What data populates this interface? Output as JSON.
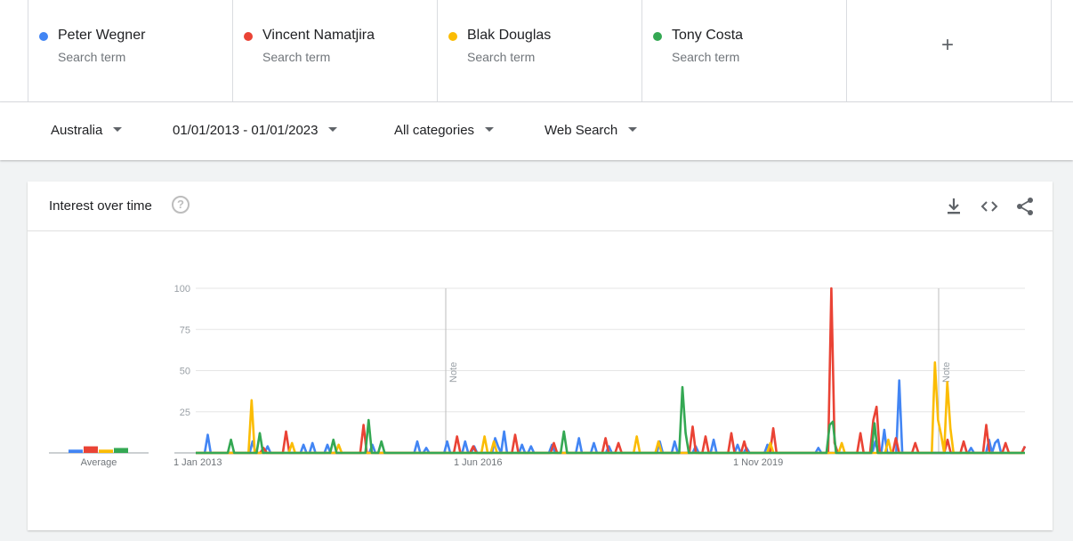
{
  "terms": [
    {
      "name": "Peter Wegner",
      "sub": "Search term",
      "color": "#4285f4"
    },
    {
      "name": "Vincent Namatjira",
      "sub": "Search term",
      "color": "#ea4335"
    },
    {
      "name": "Blak Douglas",
      "sub": "Search term",
      "color": "#fbbc04"
    },
    {
      "name": "Tony Costa",
      "sub": "Search term",
      "color": "#34a853"
    }
  ],
  "add_label": "+",
  "filters": {
    "region": "Australia",
    "date_range": "01/01/2013 - 01/01/2023",
    "category": "All categories",
    "search_type": "Web Search"
  },
  "card": {
    "title": "Interest over time",
    "help_glyph": "?",
    "icons": [
      "download-icon",
      "embed-icon",
      "share-icon"
    ]
  },
  "chart_data": {
    "type": "line",
    "ylim": [
      0,
      100
    ],
    "yticks": [
      "100",
      "75",
      "50",
      "25"
    ],
    "xticks": [
      "1 Jan 2013",
      "1 Jun 2016",
      "1 Nov 2019"
    ],
    "notes": [
      "Note",
      "Note"
    ],
    "average_label": "Average",
    "averages": [
      {
        "name": "Peter Wegner",
        "value": 2
      },
      {
        "name": "Vincent Namatjira",
        "value": 4
      },
      {
        "name": "Blak Douglas",
        "value": 2
      },
      {
        "name": "Tony Costa",
        "value": 3
      }
    ],
    "series": [
      {
        "name": "Peter Wegner",
        "color": "#4285f4",
        "values": [
          0,
          0,
          0,
          0,
          11,
          0,
          0,
          0,
          0,
          0,
          0,
          0,
          0,
          0,
          0,
          0,
          0,
          0,
          0,
          7,
          0,
          0,
          0,
          0,
          4,
          0,
          0,
          0,
          0,
          0,
          0,
          0,
          0,
          0,
          0,
          0,
          5,
          0,
          0,
          6,
          0,
          0,
          0,
          0,
          5,
          0,
          0,
          0,
          0,
          0,
          0,
          0,
          0,
          0,
          0,
          0,
          0,
          0,
          0,
          5,
          0,
          0,
          0,
          0,
          0,
          0,
          0,
          0,
          0,
          0,
          0,
          0,
          0,
          0,
          7,
          0,
          0,
          3,
          0,
          0,
          0,
          0,
          0,
          0,
          7,
          0,
          0,
          0,
          0,
          0,
          7,
          0,
          0,
          4,
          0,
          0,
          0,
          0,
          0,
          0,
          9,
          4,
          0,
          13,
          0,
          0,
          0,
          0,
          0,
          5,
          0,
          0,
          4,
          0,
          0,
          0,
          0,
          0,
          0,
          5,
          0,
          0,
          0,
          0,
          0,
          0,
          0,
          0,
          9,
          0,
          0,
          0,
          0,
          6,
          0,
          0,
          0,
          0,
          4,
          0,
          0,
          0,
          0,
          0,
          0,
          0,
          0,
          0,
          0,
          0,
          0,
          0,
          0,
          0,
          0,
          7,
          0,
          0,
          0,
          0,
          7,
          0,
          0,
          0,
          0,
          0,
          0,
          4,
          0,
          0,
          0,
          0,
          0,
          8,
          0,
          0,
          0,
          0,
          0,
          0,
          0,
          5,
          0,
          0,
          3,
          0,
          0,
          0,
          0,
          0,
          0,
          5,
          0,
          0,
          0,
          0,
          0,
          0,
          0,
          0,
          0,
          0,
          0,
          0,
          0,
          0,
          0,
          0,
          3,
          0,
          0,
          0,
          0,
          0,
          0,
          0,
          0,
          0,
          0,
          0,
          0,
          0,
          0,
          0,
          0,
          0,
          0,
          7,
          0,
          0,
          14,
          0,
          0,
          0,
          0,
          44,
          0,
          0,
          0,
          0,
          0,
          0,
          0,
          0,
          0,
          0,
          0,
          0,
          0,
          0,
          0,
          0,
          0,
          0,
          0,
          0,
          0,
          0,
          0,
          3,
          0,
          0,
          0,
          0,
          0,
          8,
          0,
          6,
          8,
          0,
          0,
          0,
          0,
          0,
          0,
          0,
          0,
          4
        ]
      },
      {
        "name": "Vincent Namatjira",
        "color": "#ea4335",
        "values": [
          0,
          0,
          0,
          0,
          0,
          0,
          0,
          0,
          0,
          0,
          0,
          0,
          0,
          0,
          0,
          0,
          0,
          0,
          0,
          0,
          0,
          3,
          0,
          0,
          0,
          0,
          0,
          0,
          13,
          0,
          0,
          0,
          0,
          0,
          0,
          0,
          0,
          0,
          0,
          0,
          0,
          0,
          0,
          0,
          0,
          0,
          0,
          0,
          0,
          0,
          0,
          0,
          17,
          0,
          0,
          0,
          0,
          0,
          0,
          0,
          0,
          0,
          0,
          0,
          0,
          0,
          0,
          0,
          0,
          0,
          0,
          0,
          0,
          0,
          0,
          0,
          0,
          0,
          0,
          0,
          0,
          10,
          0,
          0,
          0,
          0,
          4,
          0,
          0,
          0,
          0,
          0,
          0,
          0,
          0,
          0,
          0,
          0,
          0,
          11,
          0,
          0,
          0,
          0,
          0,
          0,
          0,
          0,
          0,
          0,
          0,
          6,
          0,
          0,
          0,
          0,
          0,
          0,
          0,
          0,
          0,
          0,
          0,
          0,
          0,
          0,
          0,
          9,
          0,
          0,
          0,
          6,
          0,
          0,
          0,
          0,
          0,
          0,
          0,
          0,
          0,
          0,
          0,
          0,
          0,
          0,
          0,
          0,
          0,
          0,
          0,
          0,
          0,
          0,
          16,
          0,
          0,
          0,
          10,
          0,
          0,
          0,
          0,
          0,
          0,
          0,
          12,
          0,
          0,
          0,
          7,
          0,
          0,
          0,
          0,
          0,
          0,
          0,
          0,
          15,
          0,
          0,
          0,
          0,
          0,
          0,
          0,
          0,
          0,
          0,
          0,
          0,
          0,
          0,
          0,
          0,
          0,
          100,
          6,
          0,
          0,
          0,
          0,
          0,
          0,
          0,
          12,
          0,
          0,
          0,
          20,
          28,
          0,
          0,
          0,
          0,
          0,
          9,
          0,
          0,
          0,
          0,
          0,
          6,
          0,
          0,
          0,
          0,
          0,
          0,
          0,
          0,
          0,
          8,
          0,
          0,
          0,
          0,
          7,
          0,
          0,
          0,
          0,
          0,
          0,
          17,
          0,
          0,
          0,
          0,
          0,
          6,
          0,
          0,
          0,
          0,
          0,
          4
        ]
      },
      {
        "name": "Blak Douglas",
        "color": "#fbbc04",
        "values": [
          0,
          0,
          0,
          0,
          0,
          0,
          0,
          0,
          0,
          0,
          0,
          0,
          0,
          0,
          0,
          0,
          0,
          0,
          32,
          0,
          0,
          0,
          0,
          0,
          0,
          0,
          0,
          0,
          0,
          0,
          0,
          6,
          0,
          0,
          0,
          0,
          0,
          0,
          0,
          0,
          0,
          0,
          0,
          0,
          0,
          0,
          5,
          0,
          0,
          0,
          0,
          0,
          0,
          0,
          0,
          0,
          0,
          0,
          0,
          0,
          0,
          0,
          0,
          0,
          0,
          0,
          0,
          0,
          0,
          0,
          0,
          0,
          0,
          0,
          0,
          0,
          0,
          0,
          0,
          0,
          0,
          0,
          0,
          0,
          0,
          0,
          0,
          0,
          0,
          0,
          0,
          0,
          0,
          10,
          0,
          0,
          7,
          0,
          0,
          0,
          0,
          0,
          0,
          0,
          0,
          0,
          0,
          0,
          0,
          0,
          0,
          0,
          0,
          0,
          0,
          0,
          0,
          0,
          0,
          0,
          0,
          0,
          0,
          0,
          0,
          0,
          0,
          0,
          0,
          0,
          0,
          0,
          0,
          0,
          0,
          0,
          0,
          0,
          0,
          0,
          0,
          0,
          10,
          0,
          0,
          0,
          0,
          0,
          0,
          7,
          0,
          0,
          0,
          0,
          0,
          0,
          0,
          0,
          0,
          0,
          0,
          0,
          0,
          0,
          0,
          0,
          0,
          0,
          0,
          0,
          0,
          0,
          0,
          0,
          0,
          0,
          0,
          0,
          0,
          0,
          0,
          0,
          0,
          0,
          0,
          6,
          0,
          0,
          0,
          0,
          0,
          0,
          0,
          0,
          0,
          0,
          0,
          0,
          0,
          0,
          0,
          0,
          0,
          0,
          0,
          0,
          0,
          0,
          6,
          0,
          0,
          0,
          0,
          0,
          0,
          0,
          0,
          0,
          0,
          0,
          0,
          0,
          0,
          8,
          0,
          0,
          0,
          0,
          0,
          0,
          0,
          0,
          0,
          0,
          0,
          0,
          0,
          0,
          55,
          20,
          11,
          0,
          43,
          15,
          0,
          0,
          0,
          0,
          0,
          0,
          0,
          0,
          0,
          0,
          0,
          0,
          0,
          0,
          0,
          0,
          0,
          0,
          0,
          0,
          0,
          0,
          0,
          0
        ]
      },
      {
        "name": "Tony Costa",
        "color": "#34a853",
        "values": [
          0,
          0,
          0,
          0,
          0,
          0,
          0,
          0,
          0,
          0,
          0,
          8,
          0,
          0,
          0,
          0,
          0,
          0,
          0,
          0,
          12,
          0,
          0,
          0,
          0,
          0,
          0,
          0,
          0,
          0,
          0,
          0,
          0,
          0,
          0,
          0,
          0,
          0,
          0,
          0,
          0,
          0,
          0,
          8,
          0,
          0,
          0,
          0,
          0,
          0,
          0,
          0,
          0,
          0,
          20,
          0,
          0,
          0,
          7,
          0,
          0,
          0,
          0,
          0,
          0,
          0,
          0,
          0,
          0,
          0,
          0,
          0,
          0,
          0,
          0,
          0,
          0,
          0,
          0,
          0,
          0,
          0,
          0,
          0,
          0,
          0,
          0,
          0,
          0,
          0,
          0,
          0,
          0,
          0,
          0,
          0,
          0,
          0,
          0,
          0,
          0,
          0,
          0,
          0,
          0,
          0,
          0,
          0,
          0,
          0,
          0,
          0,
          0,
          0,
          0,
          13,
          0,
          0,
          0,
          0,
          0,
          0,
          0,
          0,
          0,
          0,
          0,
          0,
          0,
          0,
          0,
          0,
          0,
          0,
          0,
          0,
          0,
          0,
          0,
          0,
          0,
          0,
          0,
          0,
          0,
          0,
          0,
          0,
          0,
          0,
          0,
          0,
          40,
          12,
          0,
          0,
          0,
          0,
          0,
          0,
          0,
          0,
          0,
          0,
          0,
          0,
          0,
          0,
          0,
          0,
          0,
          0,
          0,
          0,
          0,
          0,
          0,
          0,
          0,
          0,
          0,
          0,
          0,
          0,
          0,
          0,
          0,
          0,
          0,
          0,
          0,
          0,
          0,
          0,
          0,
          0,
          0,
          0,
          17,
          19,
          0,
          0,
          0,
          0,
          0,
          0,
          0,
          0,
          0,
          0,
          0,
          0,
          18,
          0,
          0,
          0,
          0,
          0,
          0,
          0,
          0,
          0,
          0,
          0,
          0,
          0,
          0,
          0,
          0,
          0,
          0,
          0,
          0,
          0,
          0,
          0,
          0,
          0,
          0,
          0,
          0,
          0,
          0,
          0,
          0,
          0,
          0,
          0,
          0,
          0,
          0,
          0,
          0,
          0,
          0,
          0,
          0,
          0,
          0,
          0
        ]
      }
    ]
  }
}
